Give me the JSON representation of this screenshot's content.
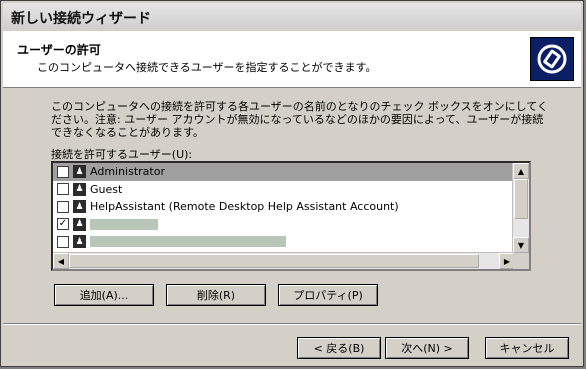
{
  "window": {
    "title": "新しい接続ウィザード"
  },
  "header": {
    "title": "ユーザーの許可",
    "subtitle": "このコンピュータへ接続できるユーザーを指定することができます。",
    "icon": "wizard-connection-icon"
  },
  "description": "このコンピュータへの接続を許可する各ユーザーの名前のとなりのチェック ボックスをオンにしてください。注意: ユーザー アカウントが無効になっているなどのほかの要因によって、ユーザーが接続できなくなることがあります。",
  "list": {
    "label": "接続を許可するユーザー(U):",
    "users": [
      {
        "name": "Administrator",
        "checked": false,
        "selected": true
      },
      {
        "name": "Guest",
        "checked": false,
        "selected": false
      },
      {
        "name": "HelpAssistant (Remote Desktop Help Assistant Account)",
        "checked": false,
        "selected": false
      },
      {
        "name": "",
        "checked": true,
        "selected": false
      },
      {
        "name": "",
        "checked": false,
        "selected": false
      },
      {
        "name": "",
        "checked": false,
        "selected": false
      }
    ]
  },
  "buttons": {
    "add": "追加(A)...",
    "delete": "削除(R)",
    "properties": "プロパティ(P)",
    "back": "< 戻る(B)",
    "next": "次へ(N) >",
    "cancel": "キャンセル"
  },
  "colors": {
    "accent_icon_bg": "#0a1f66",
    "selection": "#a0a0a0"
  }
}
